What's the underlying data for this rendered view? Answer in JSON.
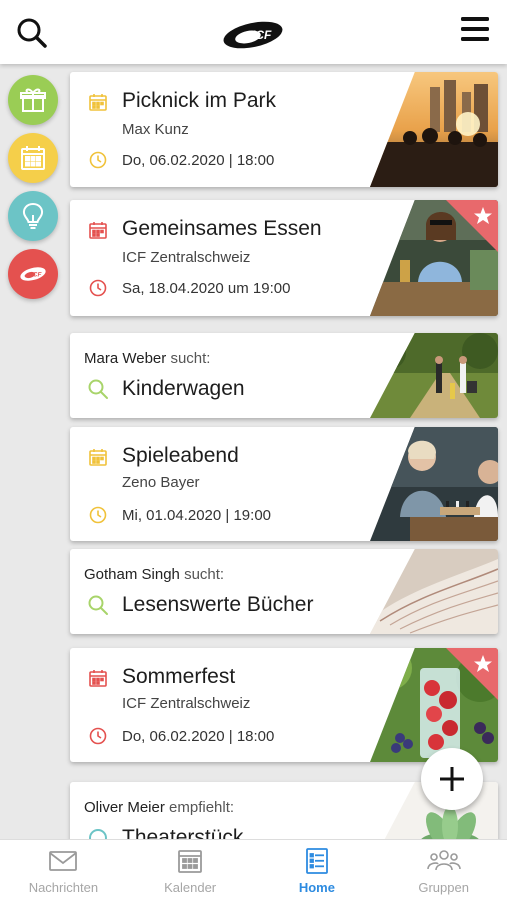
{
  "header": {
    "logo_text": "ICF"
  },
  "rail": [
    {
      "name": "gift",
      "color": "#9acd55"
    },
    {
      "name": "calendar",
      "color": "#f5cf4a"
    },
    {
      "name": "lightbulb",
      "color": "#6cc4c6"
    },
    {
      "name": "icf",
      "color": "#e4514f",
      "text": "ICF"
    }
  ],
  "cards": [
    {
      "title": "Picknick im Park",
      "subtitle": "Max Kunz",
      "date": "Do, 06.02.2020 | 18:00",
      "icon_color": "#f0c23a"
    },
    {
      "title": "Gemeinsames Essen",
      "subtitle": "ICF Zentralschweiz",
      "date": "Sa, 18.04.2020 um 19:00",
      "icon_color": "#e4514f"
    },
    {
      "person": "Mara Weber",
      "verb": "sucht:",
      "title": "Kinderwagen"
    },
    {
      "title": "Spieleabend",
      "subtitle": "Zeno Bayer",
      "date": "Mi, 01.04.2020 | 19:00",
      "icon_color": "#f0c23a"
    },
    {
      "person": "Gotham Singh",
      "verb": "sucht:",
      "title": "Lesenswerte Bücher"
    },
    {
      "title": "Sommerfest",
      "subtitle": "ICF Zentralschweiz",
      "date": "Do, 06.02.2020 | 18:00",
      "icon_color": "#e4514f"
    },
    {
      "person": "Oliver Meier",
      "verb": "empfiehlt:",
      "title": "Theaterstück"
    }
  ],
  "nav": [
    {
      "label": "Nachrichten",
      "icon": "mail-icon"
    },
    {
      "label": "Kalender",
      "icon": "calendar-icon"
    },
    {
      "label": "Home",
      "icon": "list-icon",
      "active": true
    },
    {
      "label": "Gruppen",
      "icon": "group-icon"
    }
  ],
  "colors": {
    "accent": "#2d8be0",
    "ribbon": "#e8696c",
    "seek_icon": "#a8d46a"
  }
}
